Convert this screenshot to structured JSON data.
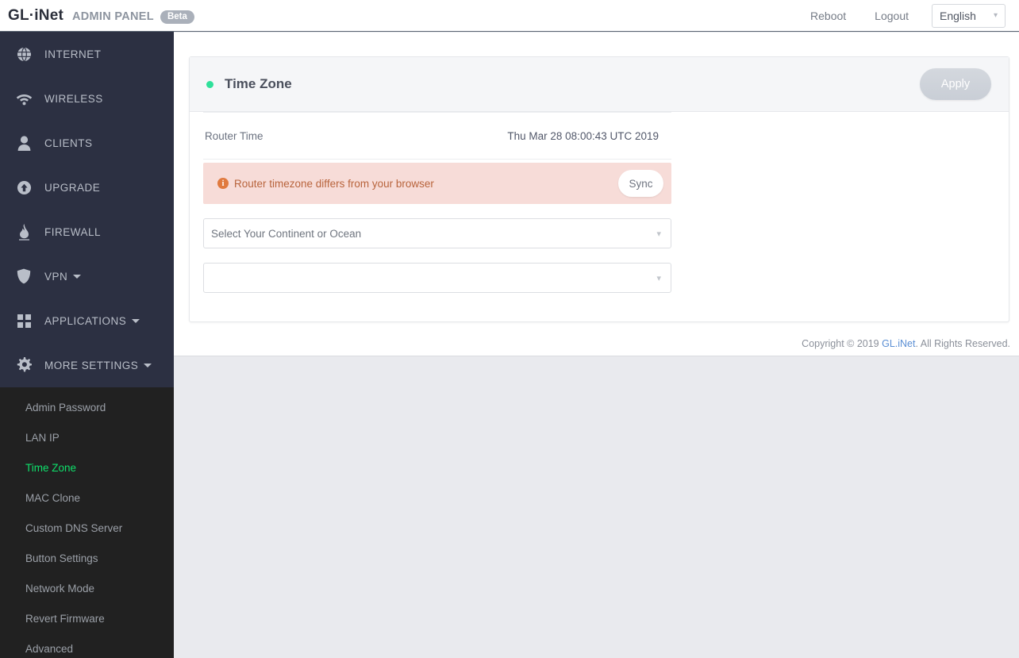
{
  "header": {
    "logo_text": "GL·iNet",
    "logo_wifi_icon": "wifi-signal-icon",
    "admin_label": "ADMIN PANEL",
    "beta_badge": "Beta",
    "reboot_label": "Reboot",
    "logout_label": "Logout",
    "language": {
      "value": "English",
      "caret_icon": "chevron-down-icon"
    }
  },
  "sidebar": {
    "items": [
      {
        "label": "INTERNET",
        "icon": "globe-icon",
        "has_caret": false
      },
      {
        "label": "WIRELESS",
        "icon": "wifi-icon",
        "has_caret": false
      },
      {
        "label": "CLIENTS",
        "icon": "user-icon",
        "has_caret": false
      },
      {
        "label": "UPGRADE",
        "icon": "upload-circle-icon",
        "has_caret": false
      },
      {
        "label": "FIREWALL",
        "icon": "flame-icon",
        "has_caret": false
      },
      {
        "label": "VPN",
        "icon": "shield-icon",
        "has_caret": true
      },
      {
        "label": "APPLICATIONS",
        "icon": "grid-icon",
        "has_caret": true
      },
      {
        "label": "MORE SETTINGS",
        "icon": "gear-icon",
        "has_caret": true
      }
    ],
    "submenu": [
      {
        "label": "Admin Password",
        "active": false
      },
      {
        "label": "LAN IP",
        "active": false
      },
      {
        "label": "Time Zone",
        "active": true
      },
      {
        "label": "MAC Clone",
        "active": false
      },
      {
        "label": "Custom DNS Server",
        "active": false
      },
      {
        "label": "Button Settings",
        "active": false
      },
      {
        "label": "Network Mode",
        "active": false
      },
      {
        "label": "Revert Firmware",
        "active": false
      },
      {
        "label": "Advanced",
        "active": false
      }
    ],
    "active_color": "#0ee06b",
    "background": "#2c3042",
    "submenu_background": "#212121"
  },
  "main": {
    "card": {
      "status_dot_color": "#2fe09a",
      "title": "Time Zone",
      "apply_label": "Apply",
      "router_time": {
        "label": "Router Time",
        "value": "Thu Mar 28 08:00:43 UTC 2019"
      },
      "alert": {
        "icon": "info-circle-icon",
        "message": "Router timezone differs from your browser",
        "sync_label": "Sync",
        "background": "#f7dcd8",
        "text_color": "#b8643c"
      },
      "continent_select": {
        "value": "Select Your Continent or Ocean",
        "caret_icon": "chevron-down-icon"
      },
      "region_select": {
        "value": "",
        "caret_icon": "chevron-down-icon"
      }
    }
  },
  "footer": {
    "prefix": "Copyright © 2019 ",
    "link": "GL.iNet",
    "suffix": ". All Rights Reserved."
  }
}
